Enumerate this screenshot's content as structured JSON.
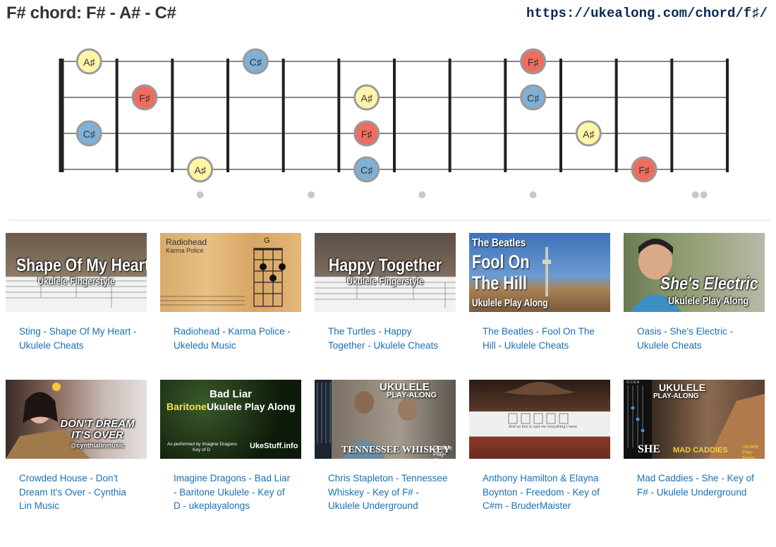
{
  "header": {
    "title": "F# chord: F# - A# - C#",
    "url": "https://ukealong.com/chord/f♯/"
  },
  "fretboard": {
    "strings": 4,
    "frets": 12,
    "colors": {
      "F♯": "#ef6d5e",
      "A♯": "#fff5a8",
      "C♯": "#7fb1d6"
    },
    "notes": [
      {
        "string": 1,
        "fret": 1,
        "label": "A♯"
      },
      {
        "string": 1,
        "fret": 4,
        "label": "C♯"
      },
      {
        "string": 1,
        "fret": 9,
        "label": "F♯"
      },
      {
        "string": 2,
        "fret": 2,
        "label": "F♯"
      },
      {
        "string": 2,
        "fret": 6,
        "label": "A♯"
      },
      {
        "string": 2,
        "fret": 9,
        "label": "C♯"
      },
      {
        "string": 3,
        "fret": 1,
        "label": "C♯"
      },
      {
        "string": 3,
        "fret": 6,
        "label": "F♯"
      },
      {
        "string": 3,
        "fret": 10,
        "label": "A♯"
      },
      {
        "string": 4,
        "fret": 3,
        "label": "A♯"
      },
      {
        "string": 4,
        "fret": 6,
        "label": "C♯"
      },
      {
        "string": 4,
        "fret": 11,
        "label": "F♯"
      }
    ],
    "markers": [
      3,
      5,
      7,
      9,
      12
    ]
  },
  "videos": [
    {
      "caption": "Sting - Shape Of My Heart - Ukulele Cheats",
      "thumb_title": "Shape Of My Heart",
      "thumb_sub": "Ukulele Fingerstyle"
    },
    {
      "caption": "Radiohead - Karma Police - Ukeledu Music",
      "thumb_title": "Radiohead",
      "thumb_sub": "Karma Police",
      "thumb_chord": "G"
    },
    {
      "caption": "The Turtles - Happy Together - Ukulele Cheats",
      "thumb_title": "Happy Together",
      "thumb_sub": "Ukulele Fingerstyle"
    },
    {
      "caption": "The Beatles - Fool On The Hill - Ukulele Cheats",
      "thumb_l1": "The Beatles",
      "thumb_l2": "Fool On",
      "thumb_l3": "The Hill",
      "thumb_sub": "Ukulele Play Along"
    },
    {
      "caption": "Oasis - She's Electric - Ukulele Cheats",
      "thumb_title": "She's Electric",
      "thumb_sub": "Ukulele Play Along"
    },
    {
      "caption": "Crowded House - Don't Dream It's Over - Cynthia Lin Music",
      "thumb_l1": "DON'T DREAM",
      "thumb_l2": "IT'S OVER",
      "thumb_sub": "@cynthialinmusic"
    },
    {
      "caption": "Imagine Dragons - Bad Liar - Baritone Ukulele - Key of D - ukeplayalongs",
      "thumb_l1": "Bad Liar",
      "thumb_l2a": "Baritone",
      "thumb_l2b": "Ukulele Play Along",
      "thumb_sub": "As performed by Imagine Dragons",
      "thumb_key": "Key of D",
      "thumb_brand": "UkeStuff.info"
    },
    {
      "caption": "Chris Stapleton - Tennessee Whiskey - Key of F# - Ukulele Underground",
      "thumb_l1": "UKULELE",
      "thumb_l2": "PLAY-ALONG",
      "thumb_l3": "TENNESSEE WHISKEY",
      "thumb_sub": "Ukulele Play-Along"
    },
    {
      "caption": "Anthony Hamilton & Elayna Boynton - Freedom - Key of C#m - BruderMaister",
      "thumb_lyric": "And so this is cast me everything I have"
    },
    {
      "caption": "Mad Caddies - She - Key of F# - Ukulele Underground",
      "thumb_l1": "UKULELE",
      "thumb_l2": "PLAY-ALONG",
      "thumb_l3": "SHE",
      "thumb_l4": "MAD CADDIES",
      "thumb_sub": "Ukulele Play-Along",
      "thumb_tuning": "G C E A"
    }
  ]
}
